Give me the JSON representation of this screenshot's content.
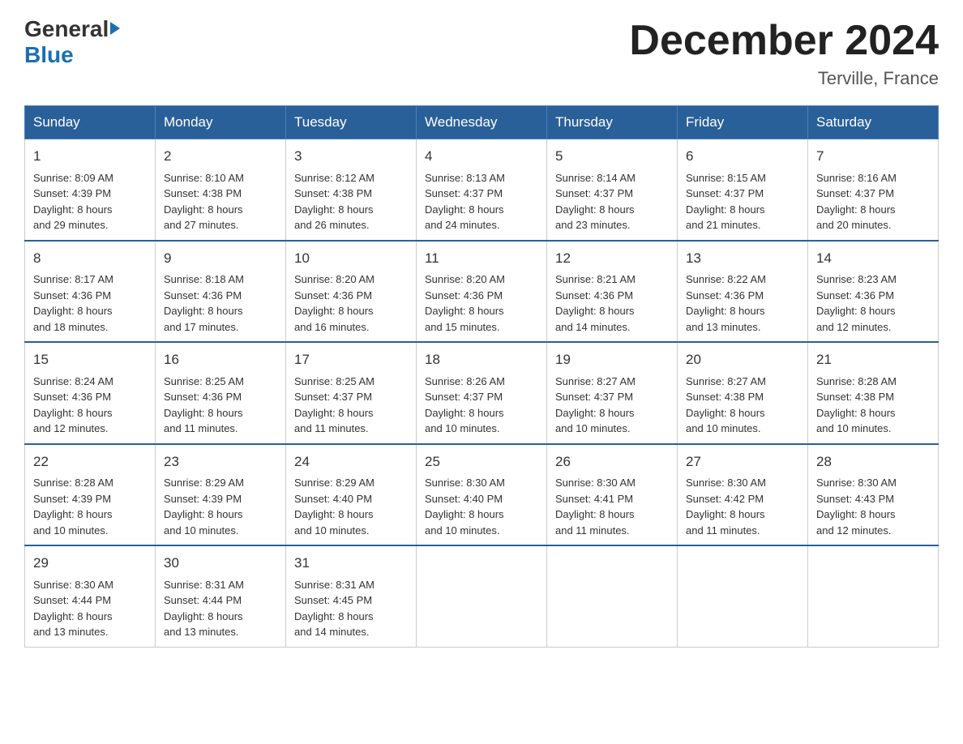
{
  "logo": {
    "general": "General",
    "blue": "Blue"
  },
  "title": "December 2024",
  "subtitle": "Terville, France",
  "days_of_week": [
    "Sunday",
    "Monday",
    "Tuesday",
    "Wednesday",
    "Thursday",
    "Friday",
    "Saturday"
  ],
  "weeks": [
    [
      {
        "day": "1",
        "sunrise": "8:09 AM",
        "sunset": "4:39 PM",
        "daylight": "8 hours and 29 minutes."
      },
      {
        "day": "2",
        "sunrise": "8:10 AM",
        "sunset": "4:38 PM",
        "daylight": "8 hours and 27 minutes."
      },
      {
        "day": "3",
        "sunrise": "8:12 AM",
        "sunset": "4:38 PM",
        "daylight": "8 hours and 26 minutes."
      },
      {
        "day": "4",
        "sunrise": "8:13 AM",
        "sunset": "4:37 PM",
        "daylight": "8 hours and 24 minutes."
      },
      {
        "day": "5",
        "sunrise": "8:14 AM",
        "sunset": "4:37 PM",
        "daylight": "8 hours and 23 minutes."
      },
      {
        "day": "6",
        "sunrise": "8:15 AM",
        "sunset": "4:37 PM",
        "daylight": "8 hours and 21 minutes."
      },
      {
        "day": "7",
        "sunrise": "8:16 AM",
        "sunset": "4:37 PM",
        "daylight": "8 hours and 20 minutes."
      }
    ],
    [
      {
        "day": "8",
        "sunrise": "8:17 AM",
        "sunset": "4:36 PM",
        "daylight": "8 hours and 18 minutes."
      },
      {
        "day": "9",
        "sunrise": "8:18 AM",
        "sunset": "4:36 PM",
        "daylight": "8 hours and 17 minutes."
      },
      {
        "day": "10",
        "sunrise": "8:20 AM",
        "sunset": "4:36 PM",
        "daylight": "8 hours and 16 minutes."
      },
      {
        "day": "11",
        "sunrise": "8:20 AM",
        "sunset": "4:36 PM",
        "daylight": "8 hours and 15 minutes."
      },
      {
        "day": "12",
        "sunrise": "8:21 AM",
        "sunset": "4:36 PM",
        "daylight": "8 hours and 14 minutes."
      },
      {
        "day": "13",
        "sunrise": "8:22 AM",
        "sunset": "4:36 PM",
        "daylight": "8 hours and 13 minutes."
      },
      {
        "day": "14",
        "sunrise": "8:23 AM",
        "sunset": "4:36 PM",
        "daylight": "8 hours and 12 minutes."
      }
    ],
    [
      {
        "day": "15",
        "sunrise": "8:24 AM",
        "sunset": "4:36 PM",
        "daylight": "8 hours and 12 minutes."
      },
      {
        "day": "16",
        "sunrise": "8:25 AM",
        "sunset": "4:36 PM",
        "daylight": "8 hours and 11 minutes."
      },
      {
        "day": "17",
        "sunrise": "8:25 AM",
        "sunset": "4:37 PM",
        "daylight": "8 hours and 11 minutes."
      },
      {
        "day": "18",
        "sunrise": "8:26 AM",
        "sunset": "4:37 PM",
        "daylight": "8 hours and 10 minutes."
      },
      {
        "day": "19",
        "sunrise": "8:27 AM",
        "sunset": "4:37 PM",
        "daylight": "8 hours and 10 minutes."
      },
      {
        "day": "20",
        "sunrise": "8:27 AM",
        "sunset": "4:38 PM",
        "daylight": "8 hours and 10 minutes."
      },
      {
        "day": "21",
        "sunrise": "8:28 AM",
        "sunset": "4:38 PM",
        "daylight": "8 hours and 10 minutes."
      }
    ],
    [
      {
        "day": "22",
        "sunrise": "8:28 AM",
        "sunset": "4:39 PM",
        "daylight": "8 hours and 10 minutes."
      },
      {
        "day": "23",
        "sunrise": "8:29 AM",
        "sunset": "4:39 PM",
        "daylight": "8 hours and 10 minutes."
      },
      {
        "day": "24",
        "sunrise": "8:29 AM",
        "sunset": "4:40 PM",
        "daylight": "8 hours and 10 minutes."
      },
      {
        "day": "25",
        "sunrise": "8:30 AM",
        "sunset": "4:40 PM",
        "daylight": "8 hours and 10 minutes."
      },
      {
        "day": "26",
        "sunrise": "8:30 AM",
        "sunset": "4:41 PM",
        "daylight": "8 hours and 11 minutes."
      },
      {
        "day": "27",
        "sunrise": "8:30 AM",
        "sunset": "4:42 PM",
        "daylight": "8 hours and 11 minutes."
      },
      {
        "day": "28",
        "sunrise": "8:30 AM",
        "sunset": "4:43 PM",
        "daylight": "8 hours and 12 minutes."
      }
    ],
    [
      {
        "day": "29",
        "sunrise": "8:30 AM",
        "sunset": "4:44 PM",
        "daylight": "8 hours and 13 minutes."
      },
      {
        "day": "30",
        "sunrise": "8:31 AM",
        "sunset": "4:44 PM",
        "daylight": "8 hours and 13 minutes."
      },
      {
        "day": "31",
        "sunrise": "8:31 AM",
        "sunset": "4:45 PM",
        "daylight": "8 hours and 14 minutes."
      },
      null,
      null,
      null,
      null
    ]
  ],
  "labels": {
    "sunrise": "Sunrise:",
    "sunset": "Sunset:",
    "daylight": "Daylight:"
  }
}
